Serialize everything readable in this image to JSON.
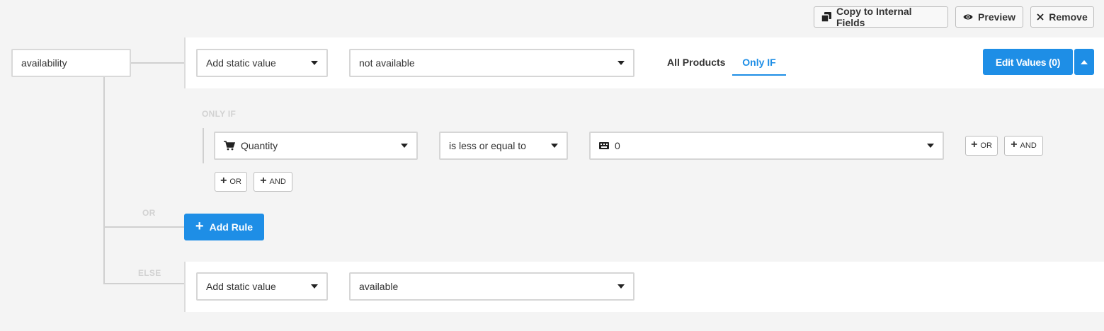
{
  "toolbar": {
    "copy_label": "Copy to Internal Fields",
    "preview_label": "Preview",
    "remove_label": "Remove"
  },
  "field": {
    "name": "availability"
  },
  "main_rule": {
    "value_type": "Add static value",
    "value": "not available",
    "tabs": [
      {
        "label": "All Products",
        "active": false
      },
      {
        "label": "Only IF",
        "active": true
      }
    ],
    "edit_values_label": "Edit Values (0)"
  },
  "only_if": {
    "section_label": "ONLY IF",
    "condition": {
      "attribute": "Quantity",
      "operator": "is less or equal to",
      "value": "0"
    },
    "or_label": "OR",
    "and_label": "AND"
  },
  "or_section": {
    "label": "OR",
    "add_rule_label": "Add Rule"
  },
  "else_section": {
    "label": "ELSE",
    "value_type": "Add static value",
    "value": "available"
  },
  "colors": {
    "accent": "#1e8ee6",
    "background": "#f4f4f4",
    "border": "#d6d6d6"
  }
}
